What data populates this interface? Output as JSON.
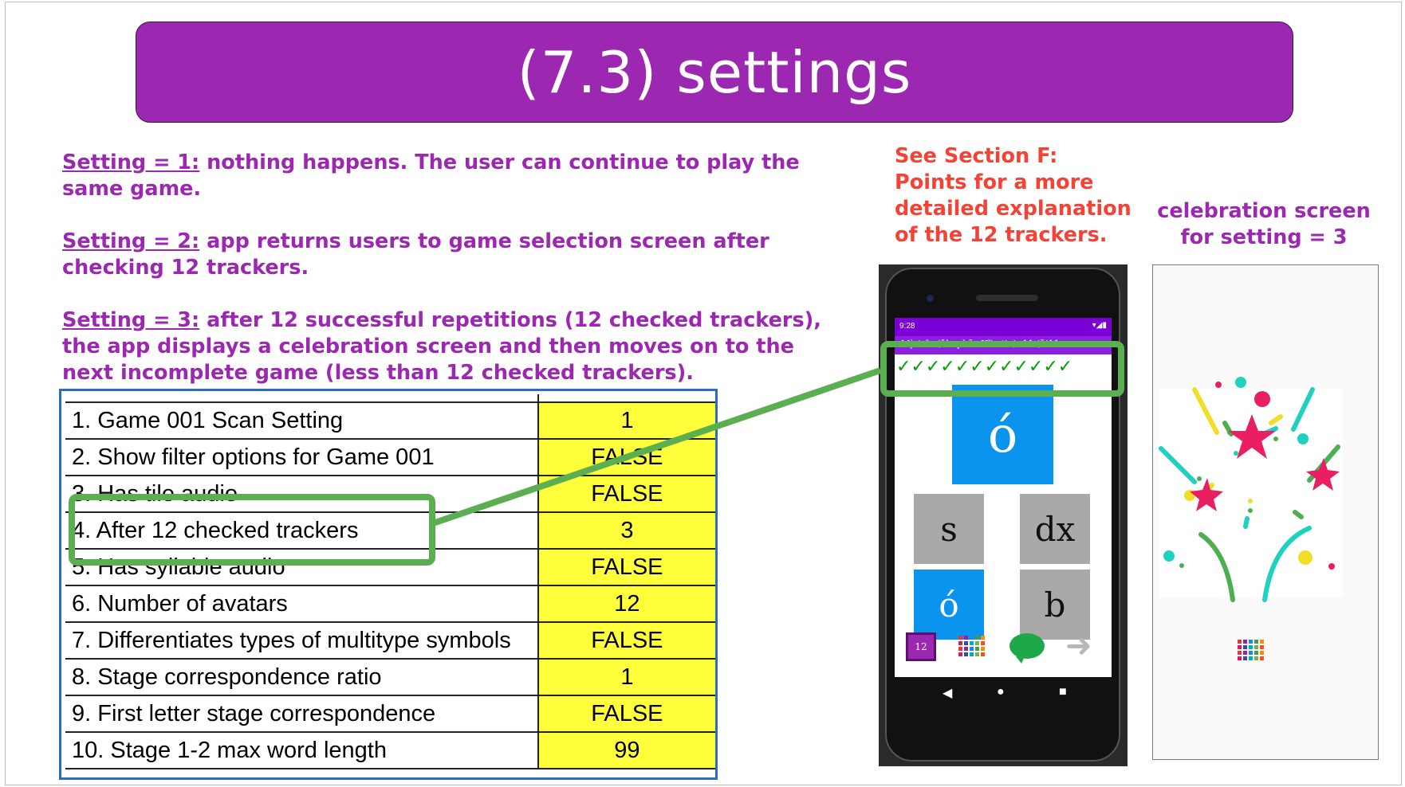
{
  "title": "(7.3) settings",
  "notes": [
    {
      "label": "Setting = 1:",
      "text": " nothing happens. The user can continue to play the same game."
    },
    {
      "label": "Setting = 2:",
      "text": " app returns users to game selection screen after checking 12 trackers."
    },
    {
      "label": "Setting = 3:",
      "text": " after 12 successful repetitions (12 checked trackers), the app displays a celebration screen and then moves on to the next incomplete game (less than 12 checked trackers)."
    }
  ],
  "section_note": "See Section F: Points for a more detailed explanation of the 12 trackers.",
  "celebration_caption": "celebration screen for setting = 3",
  "settings_table": [
    {
      "key": "1. Game 001 Scan Setting",
      "value": "1"
    },
    {
      "key": "2. Show filter options for Game 001",
      "value": "FALSE"
    },
    {
      "key": "3. Has tile audio",
      "value": "FALSE"
    },
    {
      "key": "4. After 12 checked trackers",
      "value": "3"
    },
    {
      "key": "5. Has syllable audio",
      "value": "FALSE"
    },
    {
      "key": "6. Number of avatars",
      "value": "12"
    },
    {
      "key": "7. Differentiates types of multitype symbols",
      "value": "FALSE"
    },
    {
      "key": "8. Stage correspondence ratio",
      "value": "1"
    },
    {
      "key": "9. First letter stage correspondence",
      "value": "FALSE"
    },
    {
      "key": "10. Stage 1-2 max word length",
      "value": "99"
    }
  ],
  "phone": {
    "time": "9:28",
    "status_icons": "▾◢▮",
    "app_bar_text": "Mỳ tsĩn (ũle phãa Xĩia tin): 11   (ũi11...",
    "checks": "✓✓✓✓✓✓✓✓✓✓✓✓",
    "big_tile": "ó",
    "tiles": [
      "s",
      "dx",
      "ó",
      "b"
    ],
    "level_badge": "12",
    "nav_back": "◀",
    "nav_home": "●",
    "nav_recent": "■"
  },
  "colors": {
    "title_bg": "#9c27b0",
    "notes_text": "#9c27b0",
    "section_note_text": "#f44336",
    "table_value_bg": "#ffff3b",
    "highlight_box": "#5caf50",
    "tile_blue": "#0a94ee",
    "tile_gray": "#a9a9a9"
  }
}
